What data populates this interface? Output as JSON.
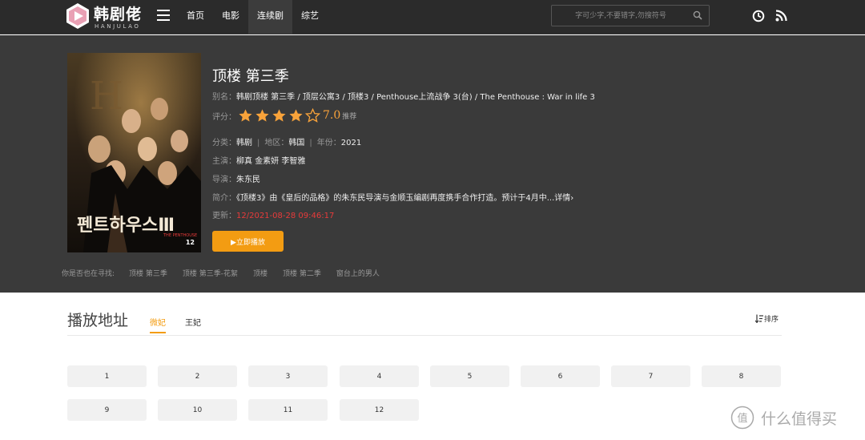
{
  "header": {
    "logo_cn": "韩剧佬",
    "logo_en": "HANJULAO",
    "nav": [
      {
        "label": "首页",
        "active": false
      },
      {
        "label": "电影",
        "active": false
      },
      {
        "label": "连续剧",
        "active": true
      },
      {
        "label": "综艺",
        "active": false
      }
    ],
    "search_placeholder": "字可少字,不要错字,勿搜符号",
    "icons": [
      "menu-icon",
      "search-icon",
      "clock-icon",
      "rss-icon"
    ]
  },
  "detail": {
    "title": "顶楼 第三季",
    "alias_label": "别名：",
    "alias_value": "韩剧顶楼 第三季 / 顶层公寓3 / 顶楼3 / Penthouse上流战争 3(台) / The Penthouse : War in life 3",
    "rating_label": "评分：",
    "rating_stars": 4,
    "rating_max": 5,
    "rating_score": "7.0",
    "rating_rec": "推荐",
    "category_label": "分类：",
    "category_value": "韩剧",
    "region_label": "地区：",
    "region_value": "韩国",
    "year_label": "年份：",
    "year_value": "2021",
    "actors_label": "主演：",
    "actors": [
      "柳真",
      "金素妍",
      "李智雅"
    ],
    "director_label": "导演：",
    "director_value": "朱东民",
    "intro_label": "简介：",
    "intro_value": "《顶楼3》由《皇后的品格》的朱东民导演与金顺玉编剧再度携手合作打造。预计于4月中...详情›",
    "update_label": "更新：",
    "update_value": "12/2021-08-28 09:46:17",
    "play_button": "▶立即播放",
    "poster_badge": "12",
    "also_label": "你是否也在寻找:",
    "also_links": [
      "顶楼 第三季",
      "顶楼 第三季-花絮",
      "顶楼",
      "顶楼 第二季",
      "窗台上的男人"
    ]
  },
  "play": {
    "section_title": "播放地址",
    "tabs": [
      {
        "label": "微妃",
        "active": true
      },
      {
        "label": "王妃",
        "active": false
      }
    ],
    "sort_label": "排序",
    "episodes": [
      "1",
      "2",
      "3",
      "4",
      "5",
      "6",
      "7",
      "8",
      "9",
      "10",
      "11",
      "12"
    ]
  },
  "watermark": {
    "text": "什么值得买",
    "icon_char": "值"
  },
  "colors": {
    "accent": "#f39c12",
    "star": "#f9a33a",
    "update": "#e83a3a",
    "header_bg": "#2b2b2b",
    "detail_bg": "#3a3a3a"
  }
}
